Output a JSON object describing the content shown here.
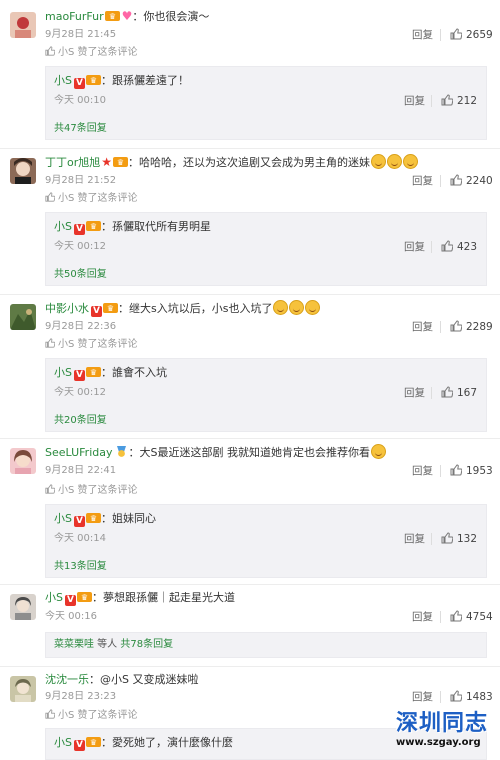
{
  "actions": {
    "reply": "回复",
    "liked_suffix": "赞了这条评论"
  },
  "comments": [
    {
      "user": "maoFurFur",
      "text": "：你也很会演～",
      "time": "9月28日 21:45",
      "likes": "2659",
      "liker": "小S",
      "sub": {
        "user": "小S",
        "text": "：跟孫儷差遠了！",
        "time": "今天 00:10",
        "likes": "212",
        "more": "共47条回复"
      }
    },
    {
      "user": "丁丁or旭旭",
      "text": "：哈哈哈，还以为这次追剧又会成为男主角的迷妹",
      "time": "9月28日 21:52",
      "likes": "2240",
      "liker": "小S",
      "sub": {
        "user": "小S",
        "text": "：孫儷取代所有男明星",
        "time": "今天 00:12",
        "likes": "423",
        "more": "共50条回复"
      }
    },
    {
      "user": "中影小水",
      "text": "：继大s入坑以后，小s也入坑了",
      "time": "9月28日 22:36",
      "likes": "2289",
      "liker": "小S",
      "sub": {
        "user": "小S",
        "text": "：誰會不入坑",
        "time": "今天 00:12",
        "likes": "167",
        "more": "共20条回复"
      }
    },
    {
      "user": "SeeLUFriday",
      "text": "：大S最近迷这部剧 我就知道她肯定也会推荐你看",
      "time": "9月28日 22:41",
      "likes": "1953",
      "liker": "小S",
      "sub": {
        "user": "小S",
        "text": "：姐妹同心",
        "time": "今天 00:14",
        "likes": "132",
        "more": "共13条回复"
      }
    },
    {
      "user": "小S",
      "text": "：夢想跟孫儷｜起走星光大道",
      "time": "今天 00:16",
      "likes": "4754",
      "more_user": "菜菜栗哇",
      "more_mid": " 等人 ",
      "more_link": "共78条回复"
    },
    {
      "user": "沈沈一乐",
      "text": "：@小S  又变成迷妹啦",
      "time": "9月28日 23:23",
      "likes": "1483",
      "liker": "小S",
      "sub": {
        "user": "小S",
        "text": "：愛死她了，演什麼像什麼"
      }
    }
  ],
  "watermark": {
    "name": "深圳同志",
    "url": "www.szgay.org"
  },
  "colors": {
    "username": "#2a8a3e",
    "badge": "#e8342a",
    "watermark": "#1d5fc4"
  },
  "avatars": [
    {
      "bg": "#e9c7b6",
      "fg": "#c0393b"
    },
    {
      "bg": "#8c6a57",
      "fg": "#f0d7c4"
    },
    {
      "bg": "#5f7a45",
      "fg": "#c9b37a"
    },
    {
      "bg": "#f3c9cc",
      "fg": "#7a4a3a"
    },
    {
      "bg": "#d8d2cc",
      "fg": "#4a4a4a"
    },
    {
      "bg": "#c9c5a6",
      "fg": "#6d6a4f"
    }
  ]
}
